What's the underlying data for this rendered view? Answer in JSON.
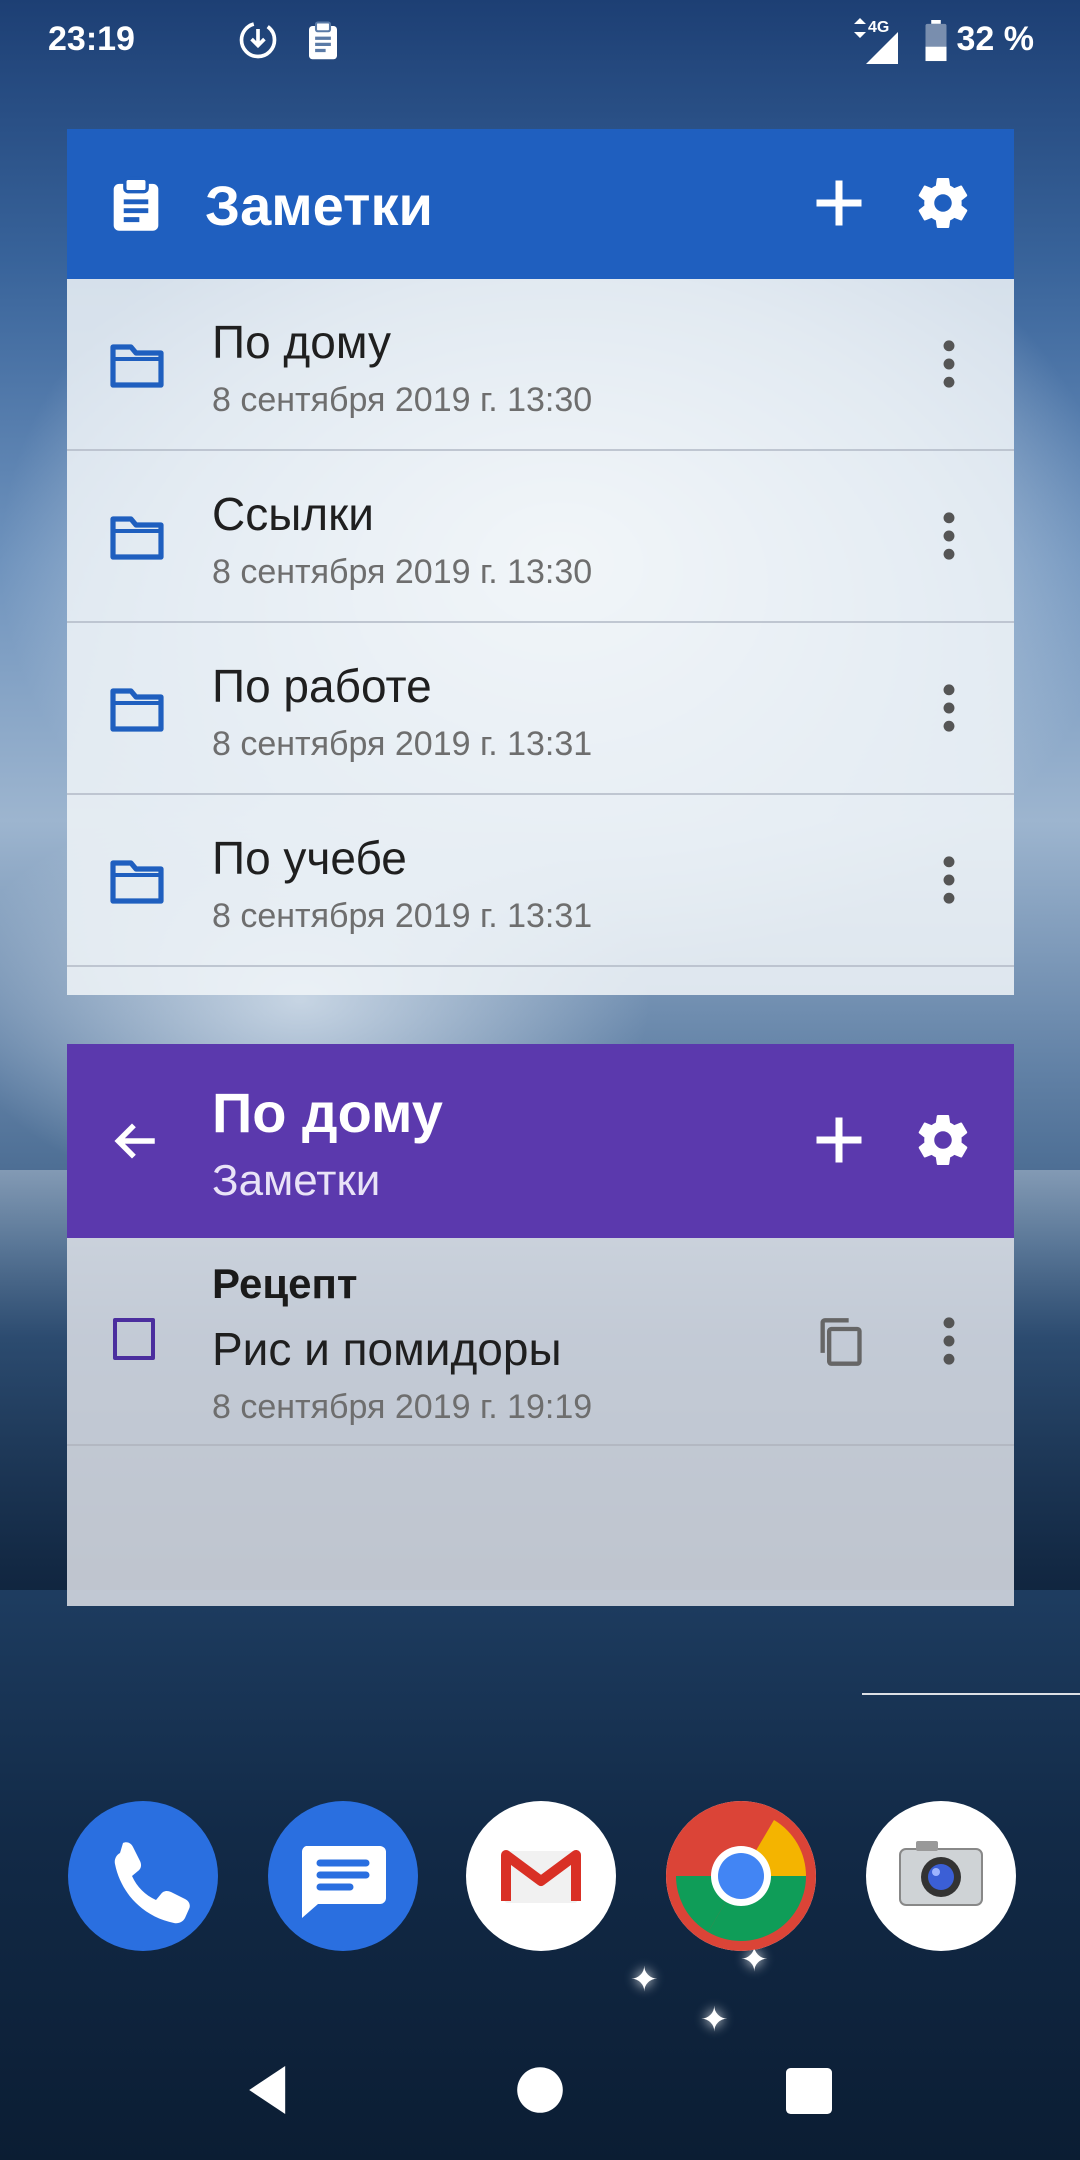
{
  "status_bar": {
    "time": "23:19",
    "network": "4G",
    "battery": "32 %"
  },
  "widget_notes": {
    "title": "Заметки",
    "items": [
      {
        "title": "По дому",
        "date": "8 сентября 2019 г. 13:30"
      },
      {
        "title": "Ссылки",
        "date": "8 сентября 2019 г. 13:30"
      },
      {
        "title": "По работе",
        "date": "8 сентября 2019 г. 13:31"
      },
      {
        "title": "По учебе",
        "date": "8 сентября 2019 г. 13:31"
      }
    ]
  },
  "widget_folder": {
    "title": "По дому",
    "subtitle": "Заметки",
    "note": {
      "title": "Рецепт",
      "body": "Рис и помидоры",
      "date": "8 сентября 2019 г. 19:19"
    }
  },
  "dock": [
    "phone-icon",
    "messages-icon",
    "gmail-icon",
    "chrome-icon",
    "camera-icon"
  ],
  "colors": {
    "notes_header": "#1f5fbf",
    "folder_header": "#5b39ad",
    "folder_icon": "#1f5fbf",
    "checkbox": "#4b2e9e"
  }
}
